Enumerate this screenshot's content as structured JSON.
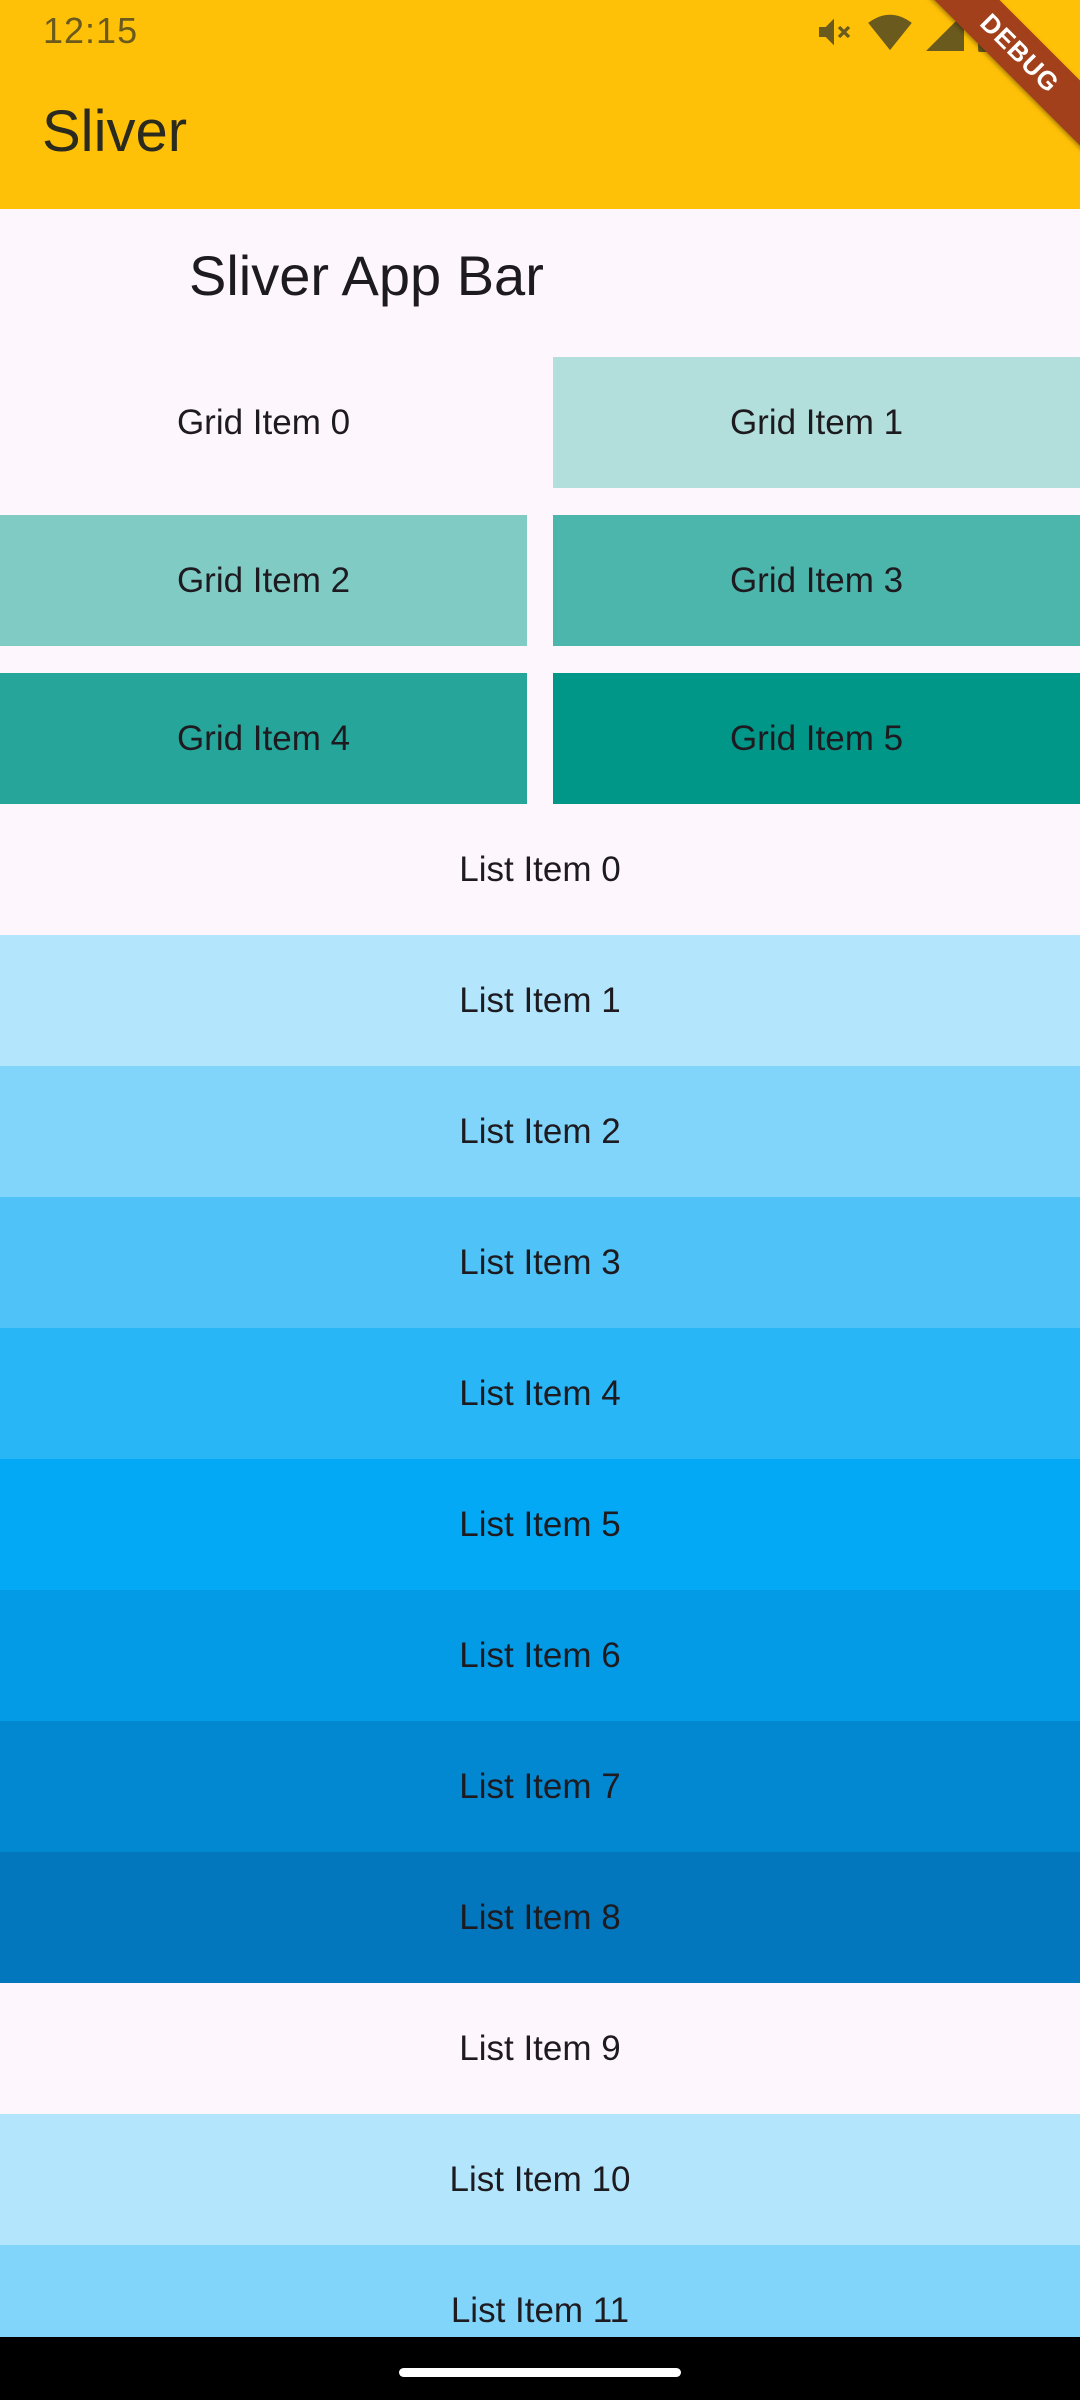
{
  "status_bar": {
    "time": "12:15",
    "icons": [
      "mute-icon",
      "wifi-icon",
      "signal-icon",
      "battery-icon"
    ]
  },
  "app_bar": {
    "title": "Sliver",
    "background": "#ffc107"
  },
  "debug_banner": {
    "label": "DEBUG",
    "color": "#a3401c"
  },
  "sliver_app_bar": {
    "title": "Sliver App Bar"
  },
  "grid": {
    "items": [
      {
        "label": "Grid Item 0",
        "color": "#fdf7fd"
      },
      {
        "label": "Grid Item 1",
        "color": "#b2dfdb"
      },
      {
        "label": "Grid Item 2",
        "color": "#80cbc4"
      },
      {
        "label": "Grid Item 3",
        "color": "#4db6ac"
      },
      {
        "label": "Grid Item 4",
        "color": "#26a69a"
      },
      {
        "label": "Grid Item 5",
        "color": "#009688"
      }
    ]
  },
  "list": {
    "items": [
      {
        "label": "List Item 0",
        "color": "#fdf7fd"
      },
      {
        "label": "List Item 1",
        "color": "#b3e5fc"
      },
      {
        "label": "List Item 2",
        "color": "#81d4fa"
      },
      {
        "label": "List Item 3",
        "color": "#4fc3f7"
      },
      {
        "label": "List Item 4",
        "color": "#29b6f6"
      },
      {
        "label": "List Item 5",
        "color": "#03a9f4"
      },
      {
        "label": "List Item 6",
        "color": "#039be5"
      },
      {
        "label": "List Item 7",
        "color": "#0288d1"
      },
      {
        "label": "List Item 8",
        "color": "#0277bd"
      },
      {
        "label": "List Item 9",
        "color": "#fdf7fd"
      },
      {
        "label": "List Item 10",
        "color": "#b3e5fc"
      },
      {
        "label": "List Item 11",
        "color": "#81d4fa"
      }
    ]
  }
}
